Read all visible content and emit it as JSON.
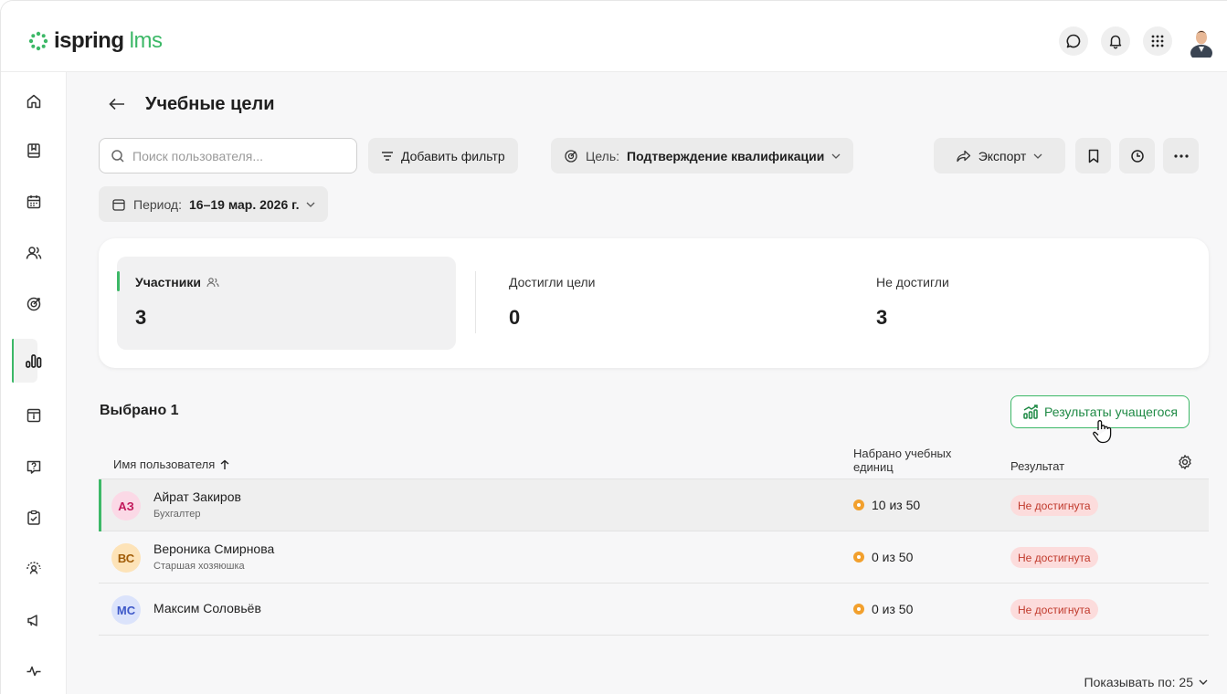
{
  "app": {
    "logo_main": "ispring",
    "logo_accent": " lms"
  },
  "header": {
    "icons": [
      "chat-icon",
      "bell-icon",
      "apps-grid-icon",
      "user-avatar"
    ]
  },
  "sidebar": {
    "items": [
      "home",
      "courses",
      "calendar",
      "users",
      "goals",
      "reports",
      "info",
      "questions",
      "tasks",
      "feedback",
      "announcements",
      "activity"
    ],
    "active": "reports"
  },
  "page": {
    "title": "Учебные цели"
  },
  "toolbar": {
    "search_placeholder": "Поиск пользователя...",
    "add_filter_label": "Добавить фильтр",
    "goal_prefix": "Цель:",
    "goal_value": "Подтверждение квалификации",
    "export_label": "Экспорт",
    "period_prefix": "Период:",
    "period_value": "16–19 мар. 2026 г."
  },
  "stats": {
    "participants_label": "Участники",
    "participants_value": "3",
    "achieved_label": "Достигли цели",
    "achieved_value": "0",
    "not_achieved_label": "Не достигли",
    "not_achieved_value": "3"
  },
  "selection": {
    "label": "Выбрано 1"
  },
  "results_button": {
    "label": "Результаты учащегося"
  },
  "table": {
    "col_name": "Имя пользователя",
    "col_units": "Набрано учебных единиц",
    "col_result": "Результат",
    "rows": [
      {
        "initials": "АЗ",
        "name": "Айрат Закиров",
        "role": "Бухгалтер",
        "units": "10 из 50",
        "result": "Не достигнута",
        "avatar_bg": "#fbd9e6",
        "avatar_fg": "#c2185b",
        "selected": true
      },
      {
        "initials": "ВС",
        "name": "Вероника Смирнова",
        "role": "Старшая хозяюшка",
        "units": "0 из 50",
        "result": "Не достигнута",
        "avatar_bg": "#fde3b8",
        "avatar_fg": "#a15c07",
        "selected": false
      },
      {
        "initials": "МС",
        "name": "Максим Соловьёв",
        "role": "",
        "units": "0 из 50",
        "result": "Не достигнута",
        "avatar_bg": "#dbe3fb",
        "avatar_fg": "#3c57c8",
        "selected": false
      }
    ]
  },
  "pagination": {
    "page_size_label": "Показывать по: 25"
  },
  "colors": {
    "accent": "#3cb867",
    "badge_bg": "#fcdcdc",
    "badge_fg": "#c0392b"
  }
}
